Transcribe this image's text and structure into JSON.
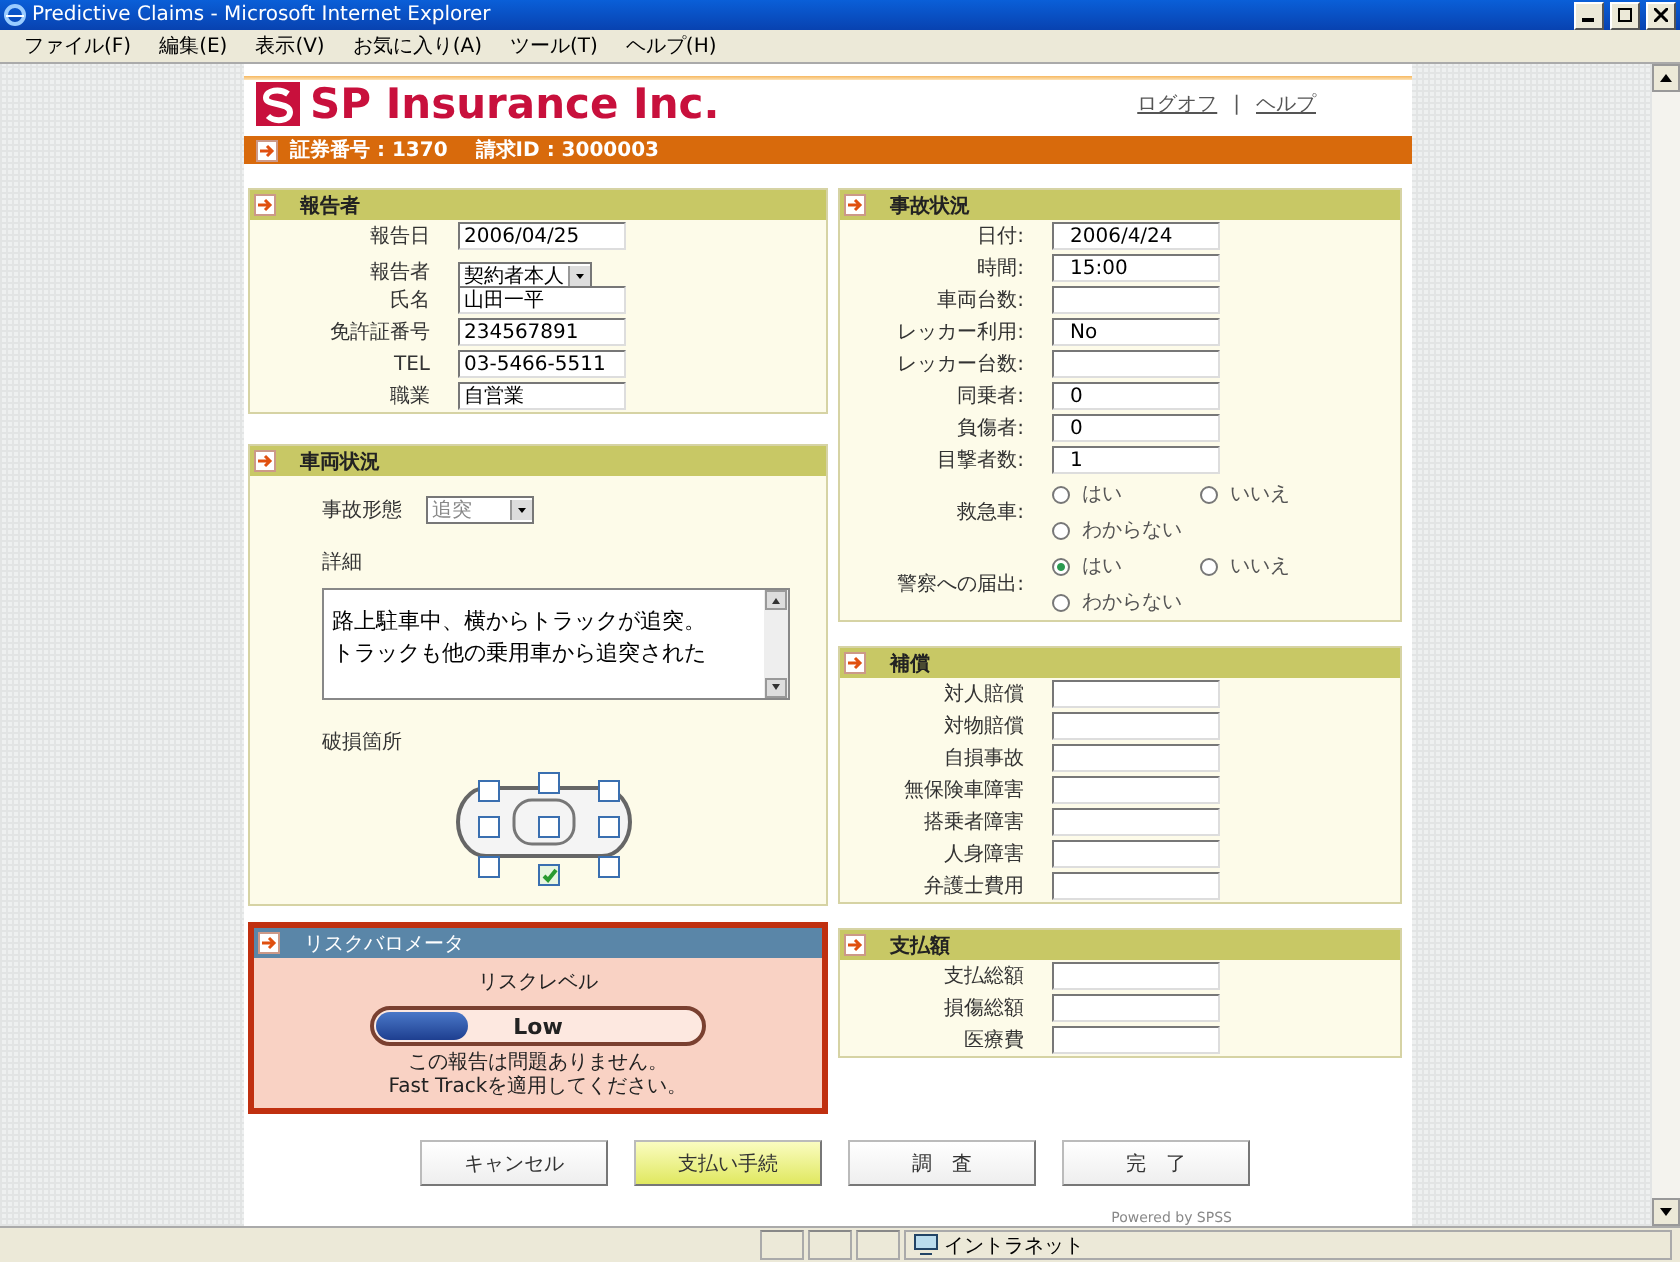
{
  "window": {
    "title": "Predictive Claims - Microsoft Internet Explorer"
  },
  "menu": [
    "ファイル(F)",
    "編集(E)",
    "表示(V)",
    "お気に入り(A)",
    "ツール(T)",
    "ヘルプ(H)"
  ],
  "header": {
    "logo_text": "SP Insurance Inc.",
    "links": [
      "ログオフ",
      "ヘルプ"
    ],
    "separator": "|"
  },
  "claim_bar": {
    "policy_label": "証券番号",
    "policy_value": ": 1370",
    "claim_label": "請求ID",
    "claim_value": ": 3000003"
  },
  "reporter": {
    "title": "報告者",
    "fields": [
      {
        "label": "報告日",
        "value": "2006/04/25",
        "kind": "text"
      },
      {
        "label": "報告者",
        "value": "契約者本人",
        "kind": "select"
      },
      {
        "label": "氏名",
        "value": "山田一平",
        "kind": "text"
      },
      {
        "label": "免許証番号",
        "value": "234567891",
        "kind": "text"
      },
      {
        "label": "TEL",
        "value": "03-5466-5511",
        "kind": "text"
      },
      {
        "label": "職業",
        "value": "自営業",
        "kind": "text"
      }
    ]
  },
  "vehicle": {
    "title": "車両状況",
    "type_label": "事故形態",
    "type_value": "追突",
    "detail_label": "詳細",
    "detail_lines": [
      "路上駐車中、横からトラックが追突。",
      "トラックも他の乗用車から追突された"
    ],
    "damage_label": "破損箇所",
    "damage_points": [
      {
        "checked": false
      },
      {
        "checked": false
      },
      {
        "checked": false
      },
      {
        "checked": false
      },
      {
        "checked": false
      },
      {
        "checked": false
      },
      {
        "checked": false
      },
      {
        "checked": true
      },
      {
        "checked": false
      }
    ]
  },
  "risk": {
    "title": "リスクバロメータ",
    "level_label": "リスクレベル",
    "level": 0.28,
    "reading": "Low",
    "message": "この報告は問題ありません。\nFast Trackを適用してください。"
  },
  "accident": {
    "title": "事故状況",
    "fields": [
      {
        "label": "日付:",
        "value": "2006/4/24"
      },
      {
        "label": "時間:",
        "value": "15:00"
      },
      {
        "label": "車両台数:"
      },
      {
        "label": "レッカー利用:",
        "value": "No"
      },
      {
        "label": "レッカー台数:"
      },
      {
        "label": "同乗者:",
        "value": "0"
      },
      {
        "label": "負傷者:",
        "value": "0"
      },
      {
        "label": "目撃者数:",
        "value": "1"
      }
    ],
    "radios": [
      {
        "label": "救急車:",
        "options": [
          {
            "label": "はい",
            "selected": false
          },
          {
            "label": "いいえ",
            "selected": false
          },
          {
            "label": "わからない",
            "selected": false
          }
        ]
      },
      {
        "label": "警察への届出:",
        "options": [
          {
            "label": "はい",
            "selected": true
          },
          {
            "label": "いいえ",
            "selected": false
          },
          {
            "label": "わからない",
            "selected": false
          }
        ]
      }
    ]
  },
  "coverage": {
    "title": "補償",
    "fields": [
      "対人賠償",
      "対物賠償",
      "自損事故",
      "無保険車障害",
      "搭乗者障害",
      "人身障害",
      "弁護士費用"
    ]
  },
  "payment": {
    "title": "支払額",
    "fields": [
      "支払総額",
      "損傷総額",
      "医療費"
    ]
  },
  "buttons": [
    {
      "label": "キャンセル",
      "primary": false
    },
    {
      "label": "支払い手続",
      "primary": true
    },
    {
      "label": "調　査",
      "primary": false
    },
    {
      "label": "完　了",
      "primary": false
    }
  ],
  "footer": "Powered by SPSS",
  "status_bar": {
    "zone": "イントラネット"
  }
}
